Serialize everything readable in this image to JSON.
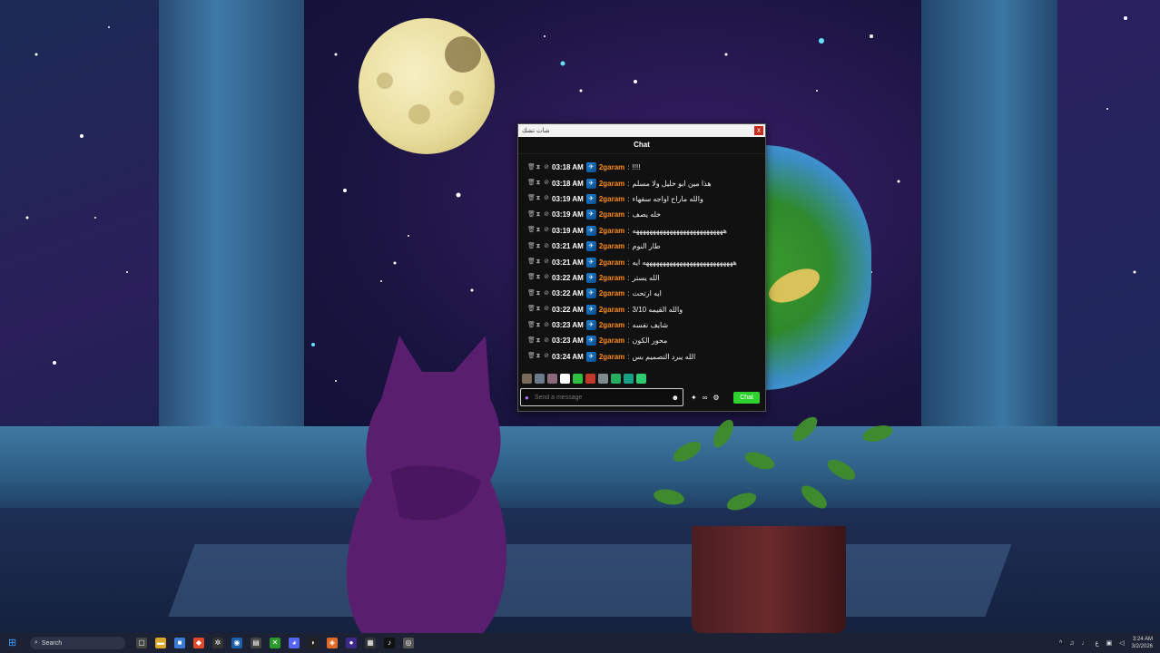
{
  "chat_window": {
    "title": "شات تشك",
    "close_label": "x",
    "header": "Chat",
    "messages": [
      {
        "time": "03:18 AM",
        "user": "2garam",
        "text": "!!!!"
      },
      {
        "time": "03:18 AM",
        "user": "2garam",
        "text": "هذا مين ابو خليل ولا مسلم"
      },
      {
        "time": "03:19 AM",
        "user": "2garam",
        "text": "والله ماراح اواجه سفهاء"
      },
      {
        "time": "03:19 AM",
        "user": "2garam",
        "text": "خله يصف"
      },
      {
        "time": "03:19 AM",
        "user": "2garam",
        "text": "هههههههههههههههههههههههههههه"
      },
      {
        "time": "03:21 AM",
        "user": "2garam",
        "text": "طار النوم"
      },
      {
        "time": "03:21 AM",
        "user": "2garam",
        "text": "هههههههههههههههههههههههههههه ايه"
      },
      {
        "time": "03:22 AM",
        "user": "2garam",
        "text": "الله يستر"
      },
      {
        "time": "03:22 AM",
        "user": "2garam",
        "text": "ايه ارتحت"
      },
      {
        "time": "03:22 AM",
        "user": "2garam",
        "text": "والله القيمه 3/10"
      },
      {
        "time": "03:23 AM",
        "user": "2garam",
        "text": "شايف نفسه"
      },
      {
        "time": "03:23 AM",
        "user": "2garam",
        "text": "محور الكون"
      },
      {
        "time": "03:24 AM",
        "user": "2garam",
        "text": "الله يبرد التصميم بس"
      }
    ],
    "input_placeholder": "Send a message",
    "send_label": "Chat",
    "colors": {
      "username": "#ff8c1a",
      "send_button": "#2fd12f"
    }
  },
  "taskbar": {
    "search_label": "Search",
    "language": "ع",
    "time": "3:24 AM",
    "date": "3/2/2026"
  }
}
